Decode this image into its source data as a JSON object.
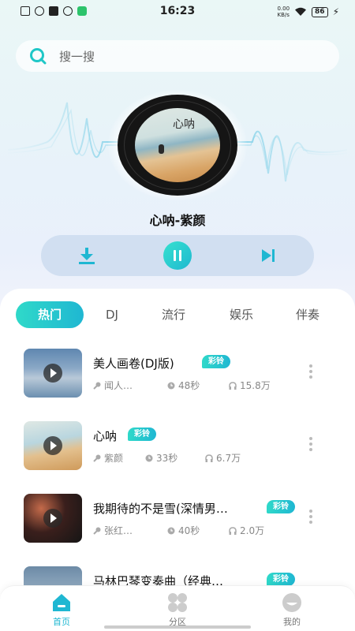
{
  "status_bar": {
    "time": "16:23",
    "net_speed_value": "0.00",
    "net_speed_unit": "KB/s",
    "battery": "86"
  },
  "search": {
    "placeholder": "搜一搜"
  },
  "player": {
    "now_playing": "心呐-紫颜",
    "cover_text": "心呐"
  },
  "tabs": [
    {
      "label": "热门",
      "active": true
    },
    {
      "label": "DJ",
      "active": false
    },
    {
      "label": "流行",
      "active": false
    },
    {
      "label": "娱乐",
      "active": false
    },
    {
      "label": "伴奏",
      "active": false
    }
  ],
  "songs": [
    {
      "title": "美人画卷(DJ版)",
      "badge": "彩铃",
      "artist": "闻人…",
      "duration": "48秒",
      "plays": "15.8万"
    },
    {
      "title": "心呐",
      "badge": "彩铃",
      "artist": "紫颜",
      "duration": "33秒",
      "plays": "6.7万"
    },
    {
      "title": "我期待的不是雪(深情男…",
      "badge": "彩铃",
      "artist": "张红…",
      "duration": "40秒",
      "plays": "2.0万"
    },
    {
      "title": "马林巴琴变奏曲（经典…",
      "badge": "彩铃"
    }
  ],
  "bottom_nav": [
    {
      "label": "首页",
      "icon": "home-icon",
      "active": true
    },
    {
      "label": "分区",
      "icon": "grid-icon",
      "active": false
    },
    {
      "label": "我的",
      "icon": "profile-icon",
      "active": false
    }
  ],
  "colors": {
    "accent": "#1fb7d2",
    "accent_light": "#2fd9c9"
  }
}
